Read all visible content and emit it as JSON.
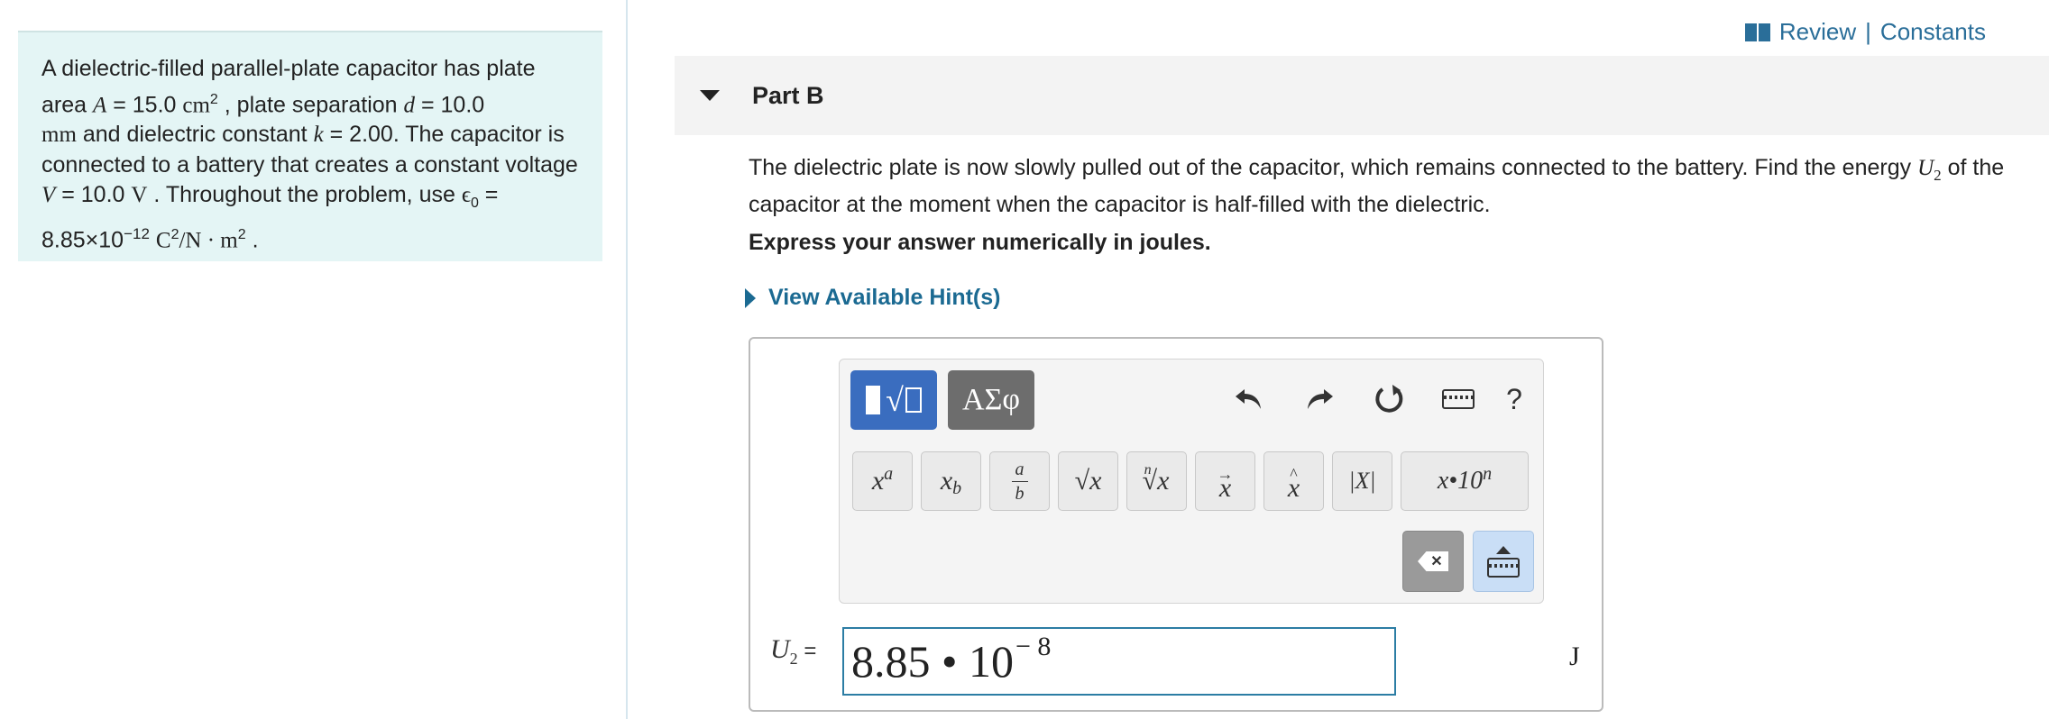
{
  "problem": {
    "t1": "A dielectric-filled parallel-plate capacitor has plate area ",
    "var_A": "A",
    "t2": " = 15.0 ",
    "unit_cm": "cm",
    "sup_2a": "2",
    "t3": " , plate separation ",
    "var_d": "d",
    "t4": " = 10.0",
    "unit_mm": "mm",
    "t5": " and dielectric constant ",
    "var_k": "k",
    "t6": " = 2.00. The capacitor is connected to a battery that creates a constant voltage ",
    "var_V": "V",
    "t7": " = 10.0 ",
    "unit_V": "V",
    "t8": " . Throughout the problem, use ",
    "eps": "ϵ",
    "eps_sub": "0",
    "t9": " = 8.85×10",
    "exp": "−12",
    "unit_C": "C",
    "sup_2b": "2",
    "unit_rest": "/N · m",
    "sup_2c": "2",
    "t10": " ."
  },
  "top_links": {
    "review": "Review",
    "sep": "|",
    "constants": "Constants"
  },
  "part": {
    "title": "Part B"
  },
  "question": {
    "text": "The dielectric plate is now slowly pulled out of the capacitor, which remains connected to the battery. Find the energy ",
    "var": "U",
    "sub": "2",
    "text2": " of the capacitor at the moment when the capacitor is half-filled with the dielectric."
  },
  "instruction": "Express your answer numerically in joules.",
  "hint_label": "View Available Hint(s)",
  "toolbar": {
    "greek_tab": "ΑΣφ",
    "help": "?",
    "keys": {
      "power_base": "x",
      "power_exp": "a",
      "sub_base": "x",
      "sub_idx": "b",
      "frac_num": "a",
      "frac_den": "b",
      "sqrt": "√x",
      "nroot_n": "n",
      "nroot": "√x",
      "vec": "x",
      "hat": "x",
      "abs": "|X|",
      "sci": "x•10",
      "sci_exp": "n"
    }
  },
  "answer": {
    "var": "U",
    "sub": "2",
    "eq": " =",
    "value": "8.85 • 10",
    "exp": "− 8",
    "unit": "J"
  }
}
